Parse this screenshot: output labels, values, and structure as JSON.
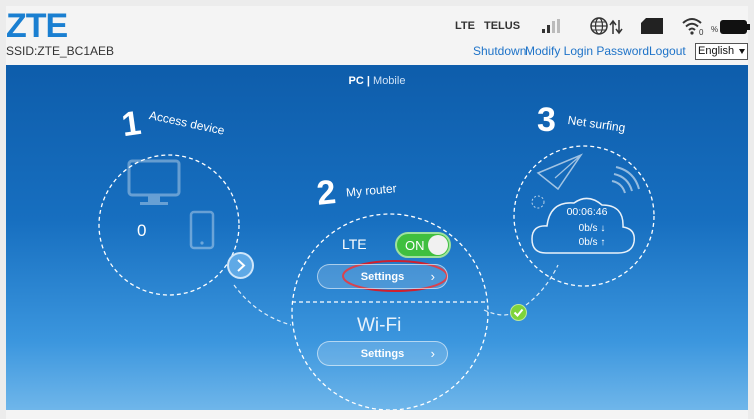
{
  "header": {
    "logo": "ZTE",
    "ssid": "SSID:ZTE_BC1AEB",
    "network_type": "LTE",
    "carrier": "TELUS",
    "links": [
      "Shutdown",
      "Modify Login Password",
      "Logout"
    ],
    "language": "English"
  },
  "view_mode": {
    "pc": "PC",
    "separator": "|",
    "mobile": "Mobile"
  },
  "steps": {
    "access": {
      "number": "1",
      "title": "Access device",
      "connected_count": "0"
    },
    "router": {
      "number": "2",
      "title": "My router",
      "lte_label": "LTE",
      "toggle_label": "ON",
      "lte_settings": "Settings",
      "wifi_label": "Wi-Fi",
      "wifi_settings": "Settings"
    },
    "surfing": {
      "number": "3",
      "title": "Net surfing",
      "duration": "00:06:46",
      "download_rate": "0b/s ↓",
      "upload_rate": "0b/s ↑"
    }
  },
  "colors": {
    "brand": "#1a7fd1",
    "link": "#1e73c8",
    "panel_top": "#0e5dab",
    "panel_bottom": "#6fb6ea",
    "toggle_on": "#3fbf3f",
    "highlight_ring": "#d0202e",
    "connected_check": "#7ed43a"
  }
}
